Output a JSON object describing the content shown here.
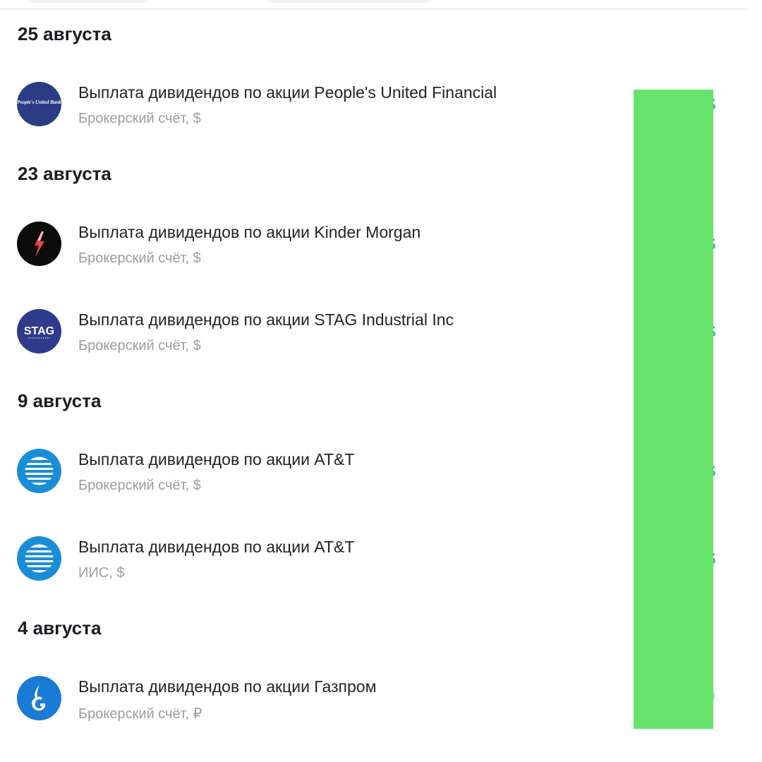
{
  "groups": [
    {
      "date": "25 августа",
      "operations": [
        {
          "title": "Выплата дивидендов по акции People's United Financial",
          "account": "Брокерский счёт, $",
          "amount_currency": "$",
          "logo_icon": "peoples-united-logo",
          "logo_text": "People's United Bank"
        }
      ]
    },
    {
      "date": "23 августа",
      "operations": [
        {
          "title": "Выплата дивидендов по акции Kinder Morgan",
          "account": "Брокерский счёт, $",
          "amount_currency": "$",
          "logo_icon": "kinder-morgan-logo"
        },
        {
          "title": "Выплата дивидендов по акции STAG Industrial Inc",
          "account": "Брокерский счёт, $",
          "amount_currency": "$",
          "logo_icon": "stag-logo",
          "logo_text": "STAG"
        }
      ]
    },
    {
      "date": "9 августа",
      "operations": [
        {
          "title": "Выплата дивидендов по акции AT&T",
          "account": "Брокерский счёт, $",
          "amount_currency": "$",
          "logo_icon": "att-globe-logo"
        },
        {
          "title": "Выплата дивидендов по акции AT&T",
          "account": "ИИС, $",
          "amount_currency": "$",
          "logo_icon": "att-globe-logo"
        }
      ]
    },
    {
      "date": "4 августа",
      "operations": [
        {
          "title": "Выплата дивидендов по акции Газпром",
          "account": "Брокерский счёт, ₽",
          "amount_currency": "₽",
          "logo_icon": "gazprom-logo"
        }
      ]
    }
  ],
  "colors": {
    "amount_usd": "#22b14c",
    "amount_rub": "#a9d7b4",
    "redaction": "#67e36d",
    "secondary_text": "#9b9ca3",
    "peoples_united": "#2c3c84",
    "stag": "#2e3a8c",
    "att_blue": "#1a8dd8",
    "gazprom_blue": "#1a7bd6"
  }
}
